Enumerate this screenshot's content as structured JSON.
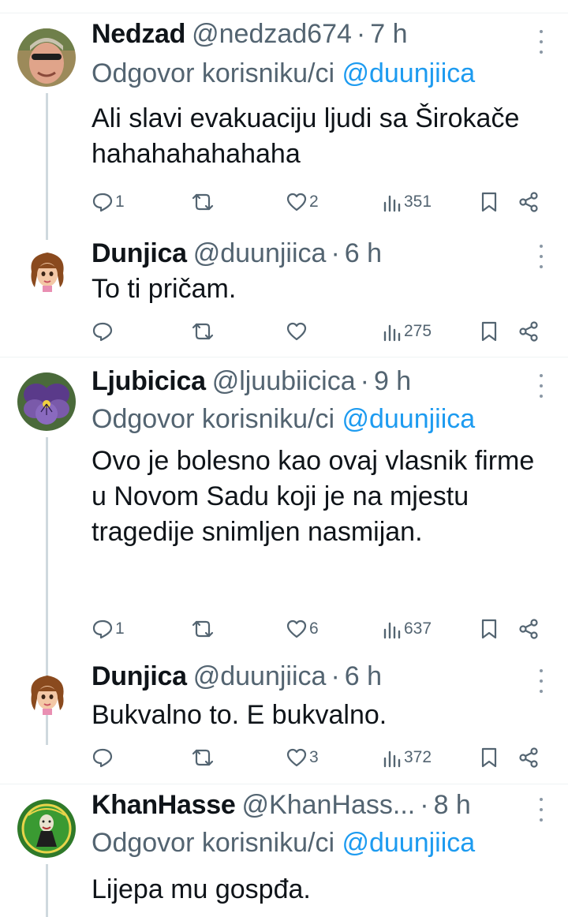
{
  "reply_prefix": "Odgovor korisniku/ci",
  "tweets": [
    {
      "name": "Nedzad",
      "handle": "@nedzad674",
      "sep": "·",
      "time": "7 h",
      "reply_mention": "@duunjiica",
      "text": "Ali slavi evakuaciju ljudi sa Širokače hahahahahahaha",
      "replies": "1",
      "retweets": "",
      "likes": "2",
      "views": "351"
    },
    {
      "name": "Dunjica",
      "handle": "@duunjiica",
      "sep": "·",
      "time": "6 h",
      "text": "To ti pričam.",
      "replies": "",
      "retweets": "",
      "likes": "",
      "views": "275"
    },
    {
      "name": "Ljubicica",
      "handle": "@ljuubiicica",
      "sep": "·",
      "time": "9 h",
      "reply_mention": "@duunjiica",
      "text": "Ovo je bolesno kao ovaj vlasnik firme u Novom Sadu koji je na mjestu tragedije snimljen nasmijan.",
      "replies": "1",
      "retweets": "",
      "likes": "6",
      "views": "637"
    },
    {
      "name": "Dunjica",
      "handle": "@duunjiica",
      "sep": "·",
      "time": "6 h",
      "text": "Bukvalno to. E bukvalno.",
      "replies": "",
      "retweets": "",
      "likes": "3",
      "views": "372"
    },
    {
      "name": "KhanHasse",
      "handle": "@KhanHass...",
      "sep": "·",
      "time": "8 h",
      "reply_mention": "@duunjiica",
      "text": "Lijepa mu gospđa."
    }
  ],
  "colors": {
    "text": "#0f1419",
    "secondary": "#536471",
    "link": "#1d9bf0",
    "divider": "#eff3f4",
    "thread_line": "#cfd9de"
  }
}
